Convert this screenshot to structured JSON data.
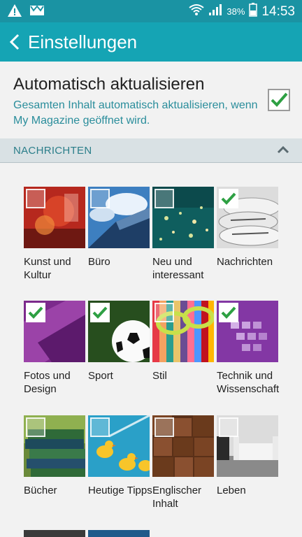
{
  "status": {
    "battery_percent": "38%",
    "time": "14:53"
  },
  "header": {
    "title": "Einstellungen"
  },
  "auto_update": {
    "title": "Automatisch aktualisieren",
    "description": "Gesamten Inhalt automatisch aktualisieren, wenn My Magazine geöffnet wird.",
    "checked": true
  },
  "section": {
    "title": "NACHRICHTEN"
  },
  "categories": [
    {
      "label": "Kunst und Kultur",
      "checked": false
    },
    {
      "label": "Büro",
      "checked": false
    },
    {
      "label": "Neu und interessant",
      "checked": false
    },
    {
      "label": "Nachrichten",
      "checked": true
    },
    {
      "label": "Fotos und Design",
      "checked": true
    },
    {
      "label": "Sport",
      "checked": true
    },
    {
      "label": "Stil",
      "checked": false
    },
    {
      "label": "Technik und Wissenschaft",
      "checked": true
    },
    {
      "label": "Bücher",
      "checked": false
    },
    {
      "label": "Heutige Tipps",
      "checked": false
    },
    {
      "label": "Englischer Inhalt",
      "checked": false
    },
    {
      "label": "Leben",
      "checked": false
    }
  ],
  "colors": {
    "accent": "#15a4b4",
    "check": "#2ea043"
  }
}
